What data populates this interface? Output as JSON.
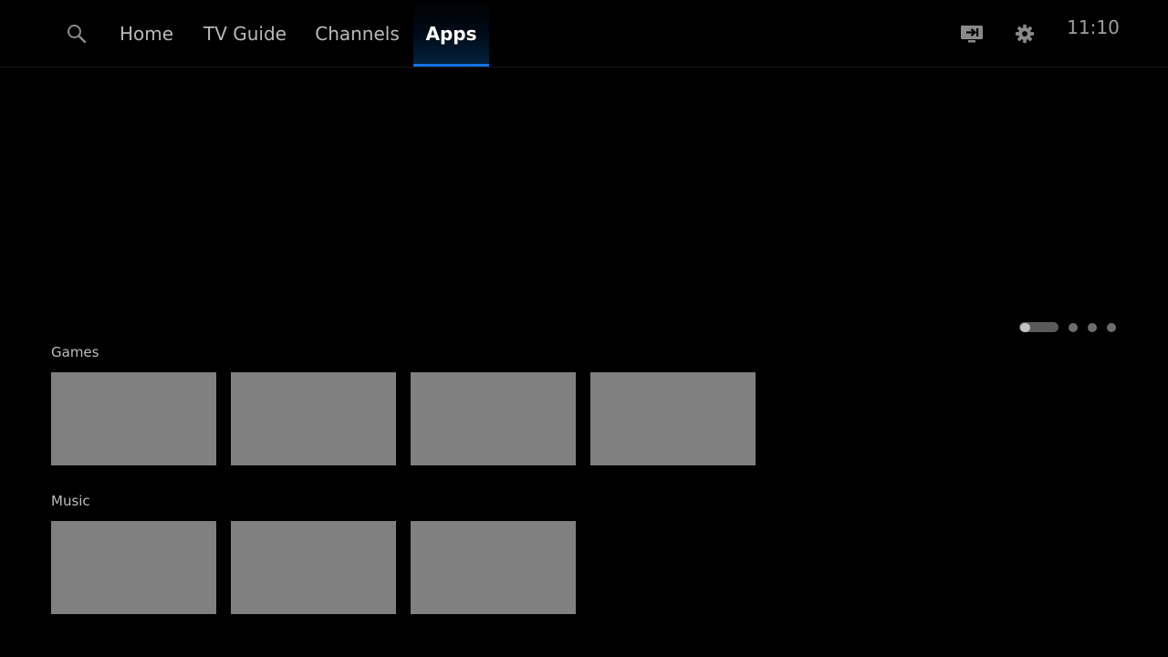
{
  "nav": {
    "tabs": [
      {
        "label": "Home",
        "active": false
      },
      {
        "label": "TV Guide",
        "active": false
      },
      {
        "label": "Channels",
        "active": false
      },
      {
        "label": "Apps",
        "active": true
      }
    ],
    "search_icon": "search-icon",
    "input_icon": "input-source-icon",
    "settings_icon": "gear-icon",
    "clock": "11:10"
  },
  "carousel": {
    "page_count": 4,
    "active_page": 1
  },
  "sections": [
    {
      "title": "Games",
      "tile_count": 4
    },
    {
      "title": "Music",
      "tile_count": 3
    }
  ],
  "colors": {
    "background": "#000000",
    "accent": "#1473e6",
    "tile": "#808080"
  }
}
